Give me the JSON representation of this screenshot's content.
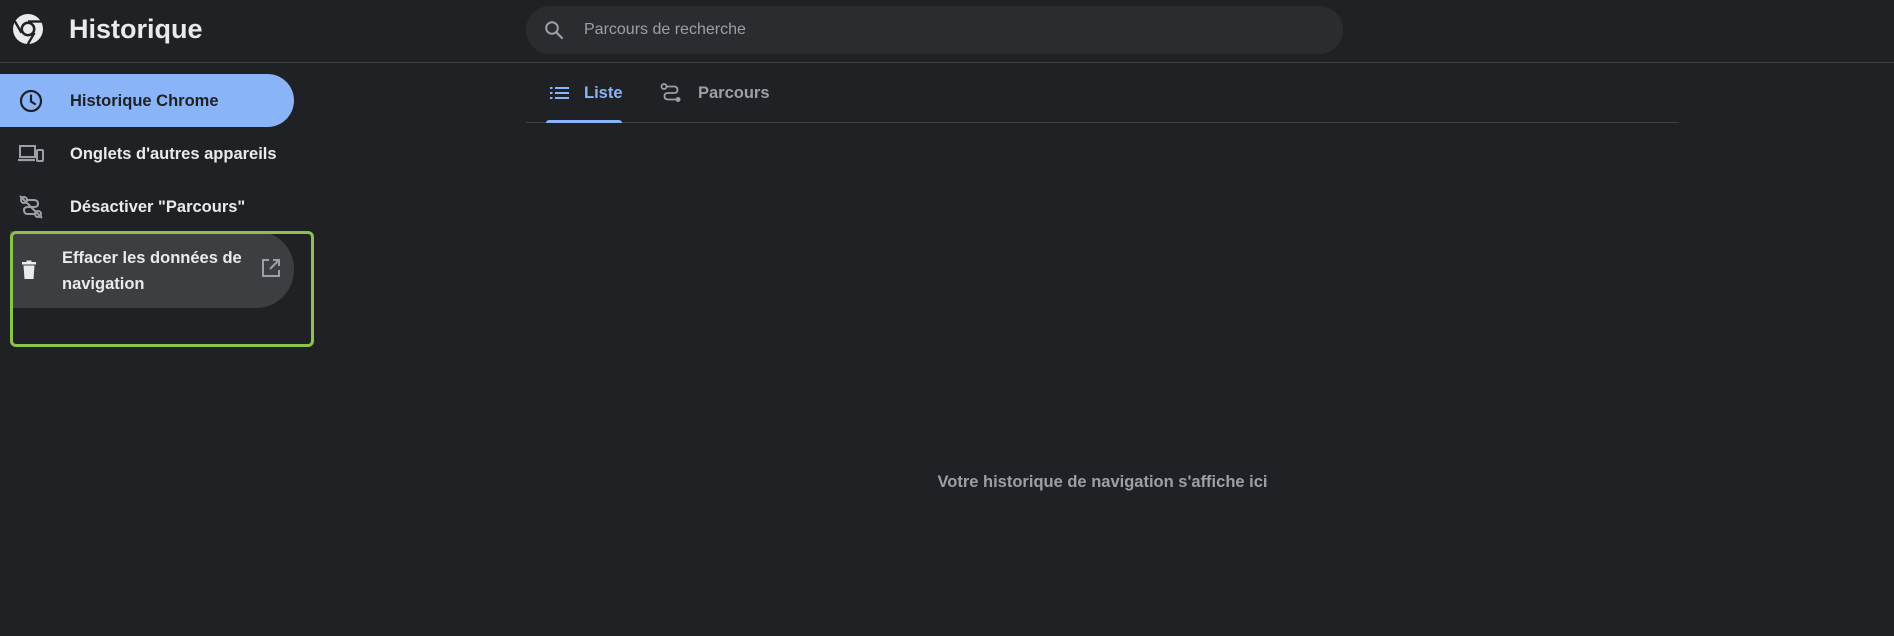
{
  "header": {
    "title": "Historique",
    "logo_icon": "chrome-logo-icon"
  },
  "search": {
    "placeholder": "Parcours de recherche",
    "value": "",
    "icon": "search-icon"
  },
  "sidebar": {
    "items": [
      {
        "label": "Historique Chrome",
        "icon": "clock-icon",
        "active": true
      },
      {
        "label": "Onglets d'autres appareils",
        "icon": "devices-icon",
        "active": false
      },
      {
        "label": "Désactiver \"Parcours\"",
        "icon": "journeys-off-icon",
        "active": false
      },
      {
        "label": "Effacer les données de navigation",
        "icon": "trash-icon",
        "trailing_icon": "open-in-new-icon",
        "active": false
      }
    ]
  },
  "tabs": [
    {
      "label": "Liste",
      "icon": "list-icon",
      "selected": true
    },
    {
      "label": "Parcours",
      "icon": "journeys-icon",
      "selected": false
    }
  ],
  "main": {
    "empty_message": "Votre historique de navigation s'affiche ici"
  },
  "colors": {
    "background": "#202124",
    "accent": "#8ab4f8",
    "highlight_border": "#8bc34a",
    "muted_text": "#9aa0a6"
  }
}
